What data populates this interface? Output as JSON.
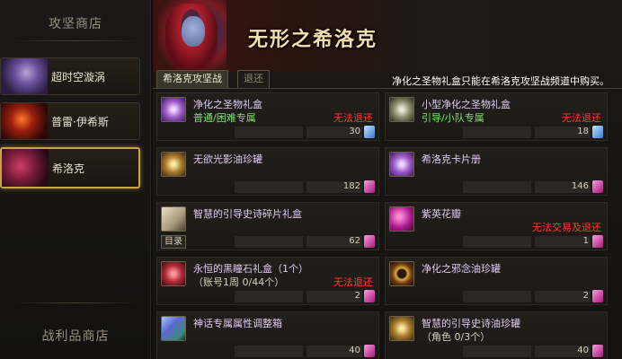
{
  "sidebar": {
    "title_top": "攻坚商店",
    "title_bottom": "战利品商店",
    "items": [
      {
        "label": "超时空漩涡"
      },
      {
        "label": "普雷·伊希斯"
      },
      {
        "label": "希洛克"
      }
    ]
  },
  "main": {
    "banner_title": "无形之希洛克",
    "tabs": [
      {
        "label": "希洛克攻坚战",
        "active": true
      },
      {
        "label": "退还",
        "active": false
      }
    ],
    "notice": "净化之圣物礼盒只能在希洛克攻坚战频道中购买。"
  },
  "cards": [
    {
      "name": "净化之圣物礼盒",
      "sub": "普通/困难专属",
      "warn": "无法退还",
      "count": "30",
      "currency": "blue"
    },
    {
      "name": "小型净化之圣物礼盒",
      "sub": "引导/小队专属",
      "warn": "无法退还",
      "count": "18",
      "currency": "blue"
    },
    {
      "name": "无欲光影油珍罐",
      "sub": "",
      "warn": "",
      "count": "182",
      "currency": "pink"
    },
    {
      "name": "希洛克卡片册",
      "sub": "",
      "warn": "",
      "count": "146",
      "currency": "pink"
    },
    {
      "name": "智慧的引导史诗碎片礼盒",
      "sub": "",
      "warn": "",
      "count": "62",
      "currency": "pink",
      "catalog": "目录"
    },
    {
      "name": "紫英花瓣",
      "sub": "",
      "warn": "无法交易及退还",
      "count": "1",
      "currency": "pink"
    },
    {
      "name": "永恒的黑瞳石礼盒（1个）",
      "sub": "（账号1周 0/44个）",
      "warn": "无法退还",
      "count": "2",
      "currency": "pink"
    },
    {
      "name": "净化之邪念油珍罐",
      "sub": "",
      "warn": "",
      "count": "2",
      "currency": "pink"
    },
    {
      "name": "神话专属属性调整箱",
      "sub": "",
      "warn": "",
      "count": "40",
      "currency": "pink"
    },
    {
      "name": "智慧的引导史诗油珍罐",
      "sub": "（角色 0/3个）",
      "warn": "",
      "count": "40",
      "currency": "pink"
    }
  ],
  "colors": {
    "accent_gold": "#c9a24a",
    "warn_red": "#ff3a2a",
    "sub_green": "#7ee36a"
  }
}
